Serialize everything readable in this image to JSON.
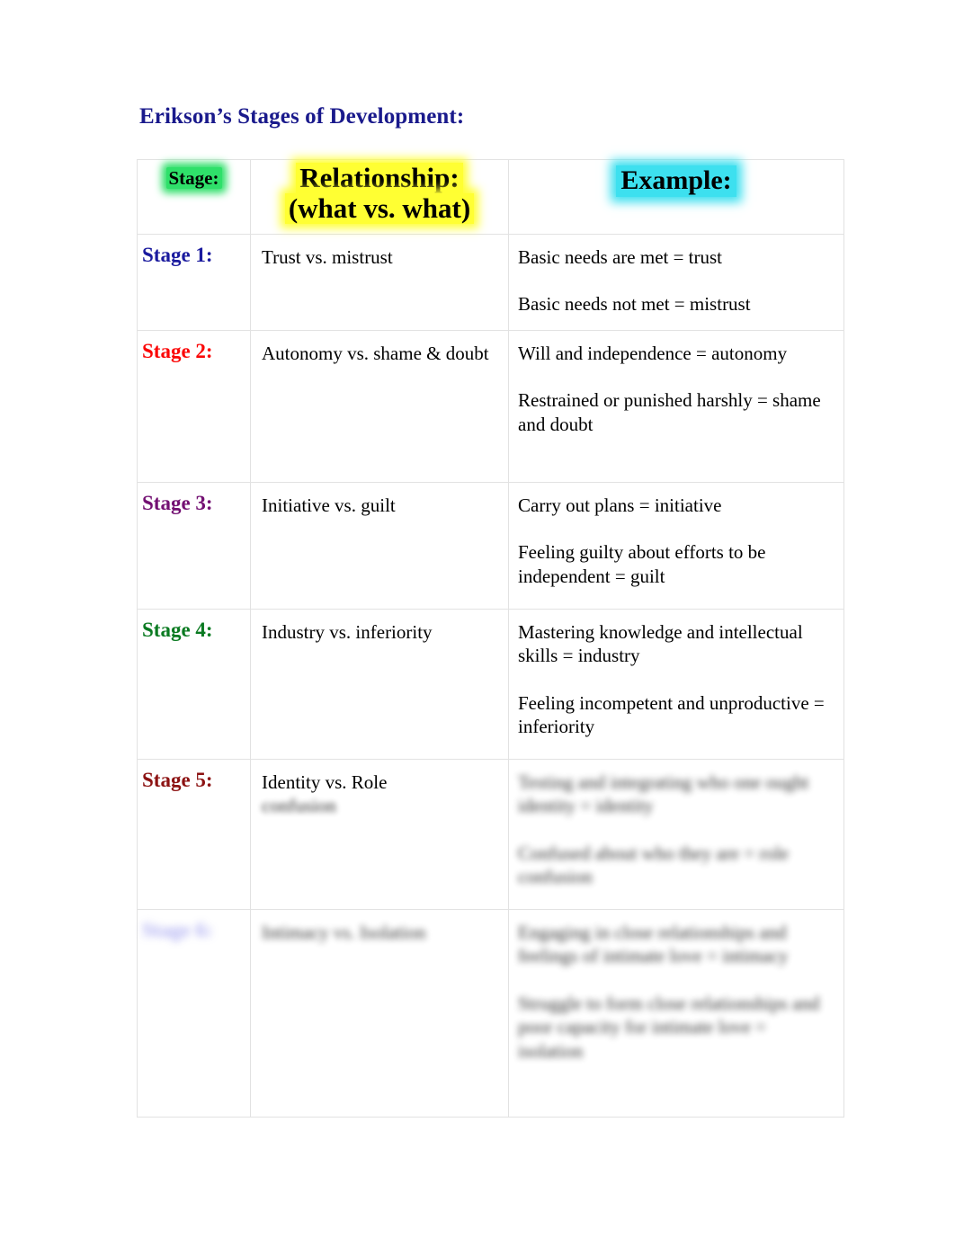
{
  "document": {
    "title": "Erikson’s Stages of Development:"
  },
  "table": {
    "headers": {
      "stage": "Stage:",
      "relationship_line1": "Relationship:",
      "relationship_line2": "(what vs. what)",
      "example": "Example:"
    },
    "header_colors": {
      "stage_highlight": "#2fe06a",
      "relationship_highlight": "#ffff33",
      "example_highlight": "#3de0ef",
      "title_color": "#1a1a8c"
    },
    "rows": [
      {
        "stage_label": "Stage 1:",
        "stage_color": "#1a1a9e",
        "relationship": "Trust vs. mistrust",
        "relationship_blurred": "",
        "examples": [
          "Basic needs are met = trust",
          "Basic needs not met = mistrust"
        ],
        "blurred": false
      },
      {
        "stage_label": "Stage 2:",
        "stage_color": "#fb0707",
        "relationship": "Autonomy vs. shame & doubt",
        "relationship_blurred": "",
        "examples": [
          "Will and independence = autonomy",
          "Restrained or punished harshly = shame and doubt"
        ],
        "blurred": false
      },
      {
        "stage_label": "Stage 3:",
        "stage_color": "#731072",
        "relationship": "Initiative vs. guilt",
        "relationship_blurred": "",
        "examples": [
          "Carry out plans = initiative",
          "Feeling guilty about efforts to be independent = guilt"
        ],
        "blurred": false
      },
      {
        "stage_label": "Stage 4:",
        "stage_color": "#0a7a21",
        "relationship": "Industry vs. inferiority",
        "relationship_blurred": "",
        "examples": [
          "Mastering knowledge and intellectual skills = industry",
          "Feeling incompetent and unproductive = inferiority"
        ],
        "blurred": false
      },
      {
        "stage_label": "Stage 5:",
        "stage_color": "#8c1212",
        "relationship": "Identity vs. Role",
        "relationship_blurred": "confusion",
        "examples": [
          "Testing and integrating who one ought identity = identity",
          "Confused about who they are = role confusion"
        ],
        "blurred": true
      },
      {
        "stage_label": "Stage 6:",
        "stage_color": "#9a9aee",
        "relationship": "",
        "relationship_blurred": "Intimacy vs. Isolation",
        "examples": [
          "Engaging in close relationships and feelings of intimate love = intimacy",
          "Struggle to form close relationships and poor capacity for intimate love = isolation"
        ],
        "blurred": true
      }
    ]
  }
}
